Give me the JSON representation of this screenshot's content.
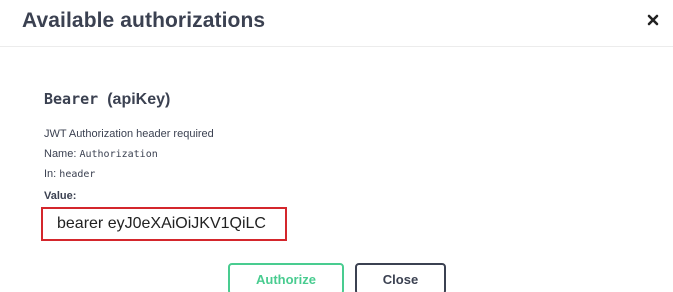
{
  "modal": {
    "title": "Available authorizations",
    "close_icon": "close-icon"
  },
  "scheme": {
    "name": "Bearer",
    "type": "(apiKey)",
    "description": "JWT Authorization header required",
    "name_label": "Name:",
    "name_value": "Authorization",
    "in_label": "In:",
    "in_value": "header",
    "value_label": "Value:",
    "value_input": "bearer eyJ0eXAiOiJKV1QiLC"
  },
  "buttons": {
    "authorize_label": "Authorize",
    "close_label": "Close"
  },
  "colors": {
    "authorize": "#49cc90",
    "highlight_border": "#d4262c",
    "text": "#3b4151"
  }
}
